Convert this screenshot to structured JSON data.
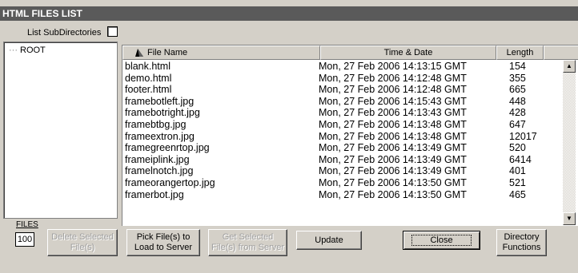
{
  "title": "HTML FILES LIST",
  "subdirectories": {
    "label": "List SubDirectories",
    "checked": false
  },
  "tree": {
    "root_label": "ROOT"
  },
  "list": {
    "columns": [
      "File Name",
      "Time & Date",
      "Length"
    ],
    "rows": [
      {
        "name": "blank.html",
        "time": "Mon, 27 Feb 2006 14:13:15 GMT",
        "length": "154"
      },
      {
        "name": "demo.html",
        "time": "Mon, 27 Feb 2006 14:12:48 GMT",
        "length": "355"
      },
      {
        "name": "footer.html",
        "time": "Mon, 27 Feb 2006 14:12:48 GMT",
        "length": "665"
      },
      {
        "name": "framebotleft.jpg",
        "time": "Mon, 27 Feb 2006 14:15:43 GMT",
        "length": "448"
      },
      {
        "name": "framebotright.jpg",
        "time": "Mon, 27 Feb 2006 14:13:43 GMT",
        "length": "428"
      },
      {
        "name": "framebtbg.jpg",
        "time": "Mon, 27 Feb 2006 14:13:48 GMT",
        "length": "647"
      },
      {
        "name": "frameextron.jpg",
        "time": "Mon, 27 Feb 2006 14:13:48 GMT",
        "length": "12017"
      },
      {
        "name": "framegreenrtop.jpg",
        "time": "Mon, 27 Feb 2006 14:13:49 GMT",
        "length": "520"
      },
      {
        "name": "frameiplink.jpg",
        "time": "Mon, 27 Feb 2006 14:13:49 GMT",
        "length": "6414"
      },
      {
        "name": "framelnotch.jpg",
        "time": "Mon, 27 Feb 2006 14:13:49 GMT",
        "length": "401"
      },
      {
        "name": "frameorangertop.jpg",
        "time": "Mon, 27 Feb 2006 14:13:50 GMT",
        "length": "521"
      },
      {
        "name": "framerbot.jpg",
        "time": "Mon, 27 Feb 2006 14:13:50 GMT",
        "length": "465"
      }
    ]
  },
  "files": {
    "label": "FILES",
    "count": "100"
  },
  "buttons": {
    "delete": "Delete Selected File(s)",
    "pick": "Pick File(s) to Load to Server",
    "get": "Get Selected File(s) from Server",
    "update": "Update",
    "close": "Close",
    "directory": "Directory Functions"
  },
  "icons": {
    "sort": "sort-arrow-icon",
    "scroll_up": "scroll-up-arrow-icon",
    "scroll_down": "scroll-down-arrow-icon"
  }
}
